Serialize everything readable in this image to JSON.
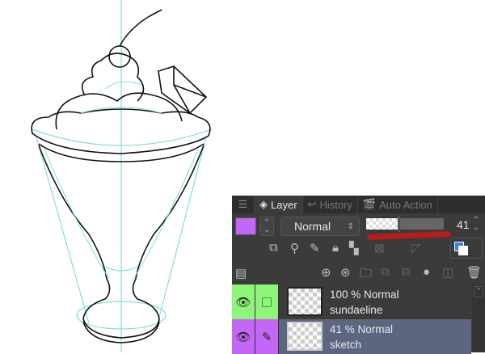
{
  "panel": {
    "tabs": [
      {
        "label": "Layer",
        "active": true
      },
      {
        "label": "History",
        "active": false
      },
      {
        "label": "Auto Action",
        "active": false
      }
    ],
    "layer_color": "#c466f6",
    "blend_mode": "Normal",
    "opacity_value": "41",
    "opacity_percent": 41
  },
  "layers": [
    {
      "opacity": "100 %",
      "mode": "Normal",
      "name": "sundaeline",
      "color": "#8ef57a",
      "selected": false
    },
    {
      "opacity": "41 %",
      "mode": "Normal",
      "name": "sketch",
      "color": "#c466f6",
      "selected": true
    }
  ]
}
